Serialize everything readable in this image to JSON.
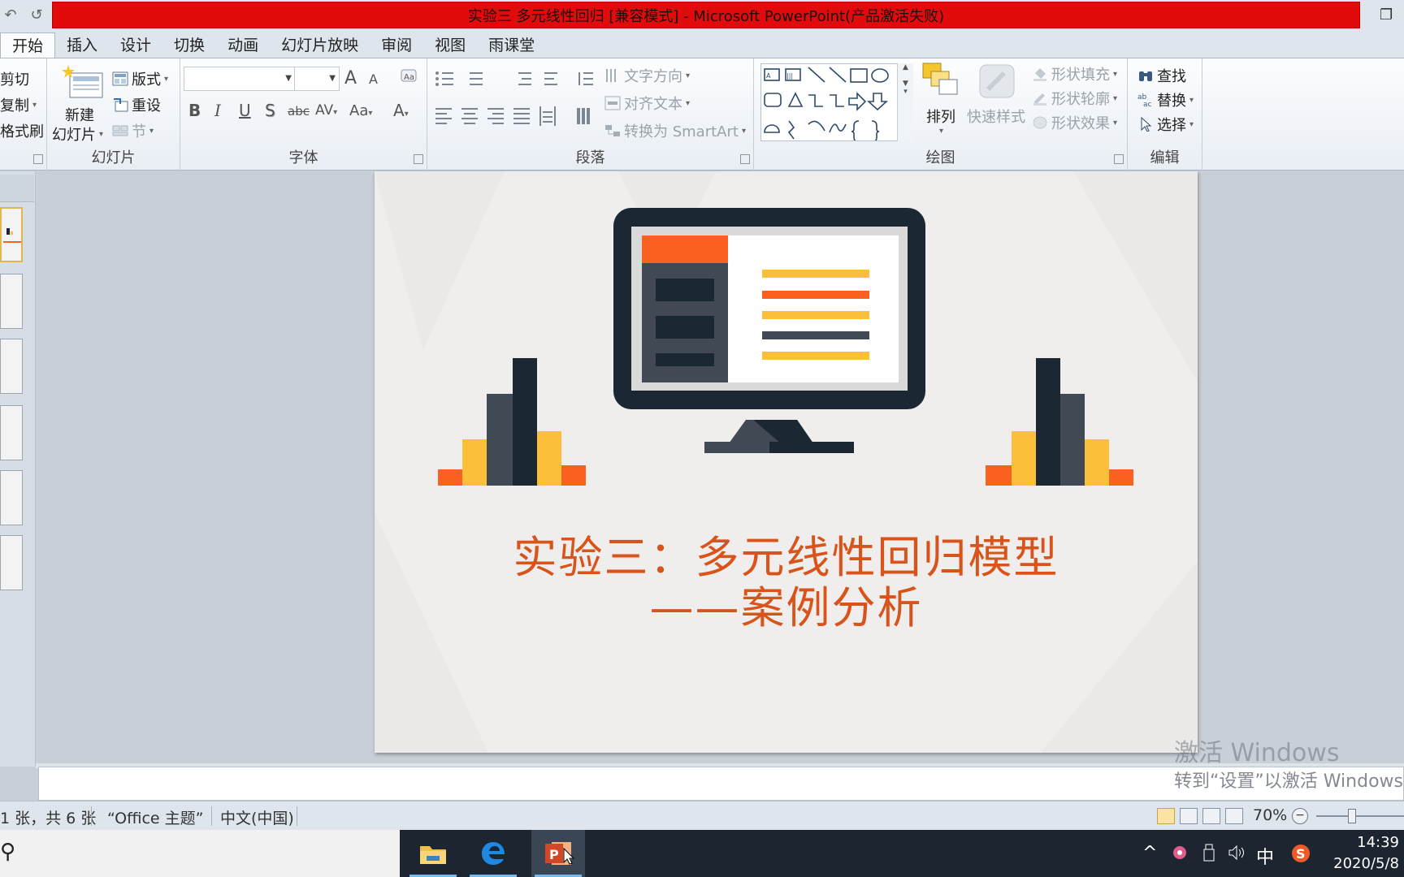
{
  "window": {
    "title": "实验三 多元线性回归 [兼容模式] - Microsoft PowerPoint(产品激活失败)",
    "title_bar_color": "#e20b0b",
    "qat": {
      "undo_glyph": "↶",
      "redo_glyph": "↺",
      "customize_glyph": "▾"
    },
    "restore_glyph": "❐"
  },
  "ribbon_tabs": [
    "开始",
    "插入",
    "设计",
    "切换",
    "动画",
    "幻灯片放映",
    "审阅",
    "视图",
    "雨课堂"
  ],
  "active_tab": "开始",
  "ribbon": {
    "clipboard": {
      "cut": "剪切",
      "copy": "复制",
      "format_painter": "格式刷"
    },
    "slides": {
      "new_slide_line1": "新建",
      "new_slide_line2": "幻灯片",
      "layout": "版式",
      "reset": "重设",
      "section": "节",
      "group_label": "幻灯片"
    },
    "font": {
      "group_label": "字体",
      "font_name": "",
      "font_size": "",
      "grow": "A",
      "shrink": "A",
      "bold": "B",
      "italic": "I",
      "underline": "U",
      "shadow": "S",
      "strike": "abc",
      "spacing": "AV",
      "case": "Aa",
      "color": "A"
    },
    "paragraph": {
      "group_label": "段落",
      "text_direction": "文字方向",
      "align_text": "对齐文本",
      "smartart": "转换为 SmartArt"
    },
    "drawing": {
      "group_label": "绘图",
      "arrange": "排列",
      "quick_styles": "快速样式",
      "shape_fill": "形状填充",
      "shape_outline": "形状轮廓",
      "shape_effects": "形状效果"
    },
    "editing": {
      "group_label": "编辑",
      "find": "查找",
      "replace": "替换",
      "select": "选择"
    }
  },
  "slide": {
    "title_line1": "实验三：多元线性回归模型",
    "title_line2": "——案例分析",
    "title_color": "#d8541a",
    "palette": {
      "navy": "#1b2733",
      "slate": "#414a54",
      "orange": "#fa6020",
      "yellow": "#fbbf3a",
      "screen_gray": "#dadada"
    }
  },
  "watermark": {
    "line1": "激活 Windows",
    "line2": "转到“设置”以激活 Windows。"
  },
  "status_bar": {
    "slide_count": "1 张，共 6 张",
    "theme": "“Office 主题”",
    "language": "中文(中国)",
    "zoom": "70%"
  },
  "taskbar": {
    "search_glyph": "⚲",
    "ime": "中",
    "time": "14:39",
    "date": "2020/5/8",
    "tray_up": "^"
  }
}
